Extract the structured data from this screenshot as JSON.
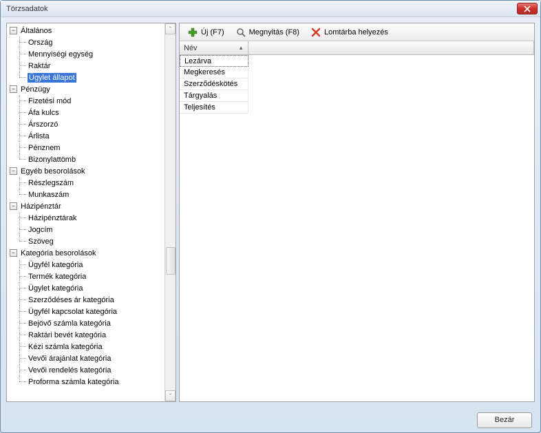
{
  "window": {
    "title": "Törzsadatok"
  },
  "tree": {
    "groups": [
      {
        "label": "Általános",
        "items": [
          "Ország",
          "Mennyiségi egység",
          "Raktár",
          "Ügylet állapot"
        ],
        "selectedIndex": 3
      },
      {
        "label": "Pénzügy",
        "items": [
          "Fizetési mód",
          "Áfa kulcs",
          "Árszorzó",
          "Árlista",
          "Pénznem",
          "Bizonylattömb"
        ]
      },
      {
        "label": "Egyéb besorolások",
        "items": [
          "Részlegszám",
          "Munkaszám"
        ]
      },
      {
        "label": "Házipénztár",
        "items": [
          "Házipénztárak",
          "Jogcím",
          "Szöveg"
        ]
      },
      {
        "label": "Kategória besorolások",
        "items": [
          "Ügyfél kategória",
          "Termék kategória",
          "Ügylet kategória",
          "Szerződéses ár kategória",
          "Ügyfél kapcsolat kategória",
          "Bejövő számla kategória",
          "Raktári bevét kategória",
          "Kézi számla kategória",
          "Vevői árajánlat kategória",
          "Vevői rendelés kategória",
          "Proforma számla kategória"
        ]
      }
    ]
  },
  "toolbar": {
    "new": "Új (F7)",
    "open": "Megnyitás (F8)",
    "trash": "Lomtárba helyezés"
  },
  "grid": {
    "header": {
      "name": "Név",
      "sort_indicator": "▲"
    },
    "rows": [
      "Lezárva",
      "Megkeresés",
      "Szerződéskötés",
      "Tárgyalás",
      "Teljesítés"
    ],
    "selectedIndex": 0
  },
  "footer": {
    "close": "Bezár"
  }
}
